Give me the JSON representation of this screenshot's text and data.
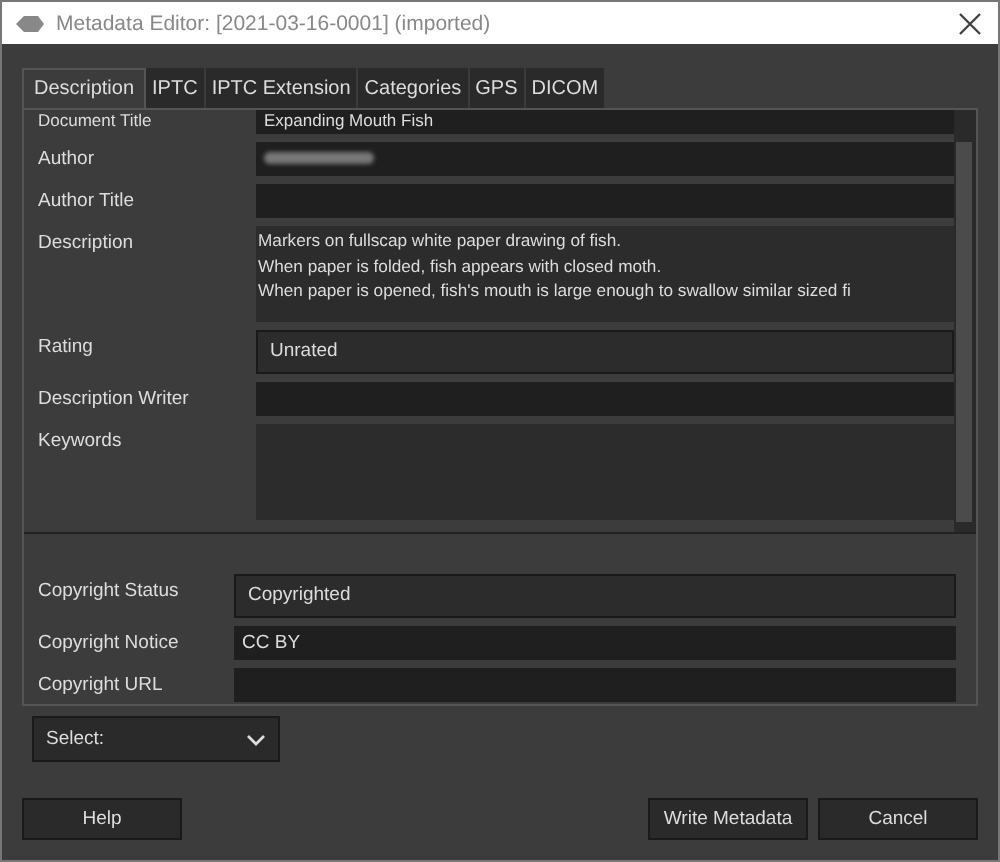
{
  "window": {
    "title": "Metadata Editor: [2021-03-16-0001] (imported)"
  },
  "tabs": [
    {
      "label": "Description",
      "selected": true
    },
    {
      "label": "IPTC",
      "selected": false
    },
    {
      "label": "IPTC Extension",
      "selected": false
    },
    {
      "label": "Categories",
      "selected": false
    },
    {
      "label": "GPS",
      "selected": false
    },
    {
      "label": "DICOM",
      "selected": false
    }
  ],
  "fields": [
    {
      "label": "Document Title",
      "kind": "text",
      "value": "Expanding Mouth Fish"
    },
    {
      "label": "Author",
      "kind": "redacted"
    },
    {
      "label": "Author Title",
      "kind": "text"
    },
    {
      "label": "Description",
      "kind": "textarea",
      "lines": [
        "Markers on fullscap white paper drawing of fish.",
        "When paper is folded, fish appears with closed moth.",
        "When paper is opened, fish's mouth is large enough to swallow similar sized fi"
      ]
    },
    {
      "label": "Rating",
      "kind": "combo",
      "value": "Unrated"
    },
    {
      "label": "Description Writer",
      "kind": "text"
    },
    {
      "label": "Keywords",
      "kind": "textarea"
    }
  ],
  "copyright": [
    {
      "label": "Copyright Status",
      "kind": "combo",
      "value": "Copyrighted"
    },
    {
      "label": "Copyright Notice",
      "kind": "text",
      "value": "CC BY"
    },
    {
      "label": "Copyright URL",
      "kind": "text"
    }
  ],
  "select": {
    "label": "Select:"
  },
  "buttons": {
    "help": "Help",
    "write": "Write Metadata",
    "cancel": "Cancel"
  }
}
